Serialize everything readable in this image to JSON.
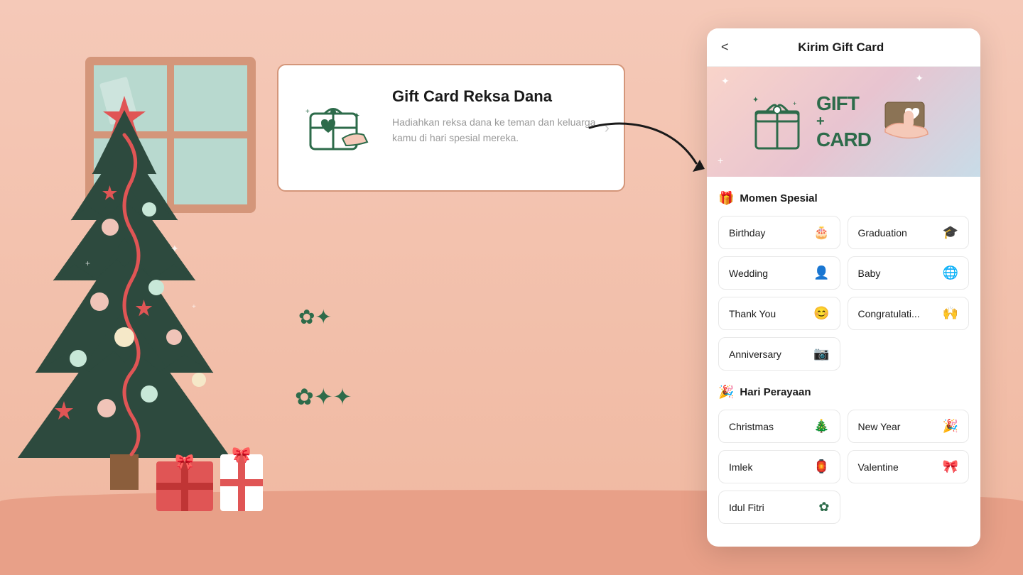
{
  "app": {
    "title": "Kirim Gift Card",
    "back_label": "<"
  },
  "feature_card": {
    "title": "Gift Card Reksa Dana",
    "description": "Hadiahkan reksa dana ke teman dan keluarga kamu di hari spesial mereka."
  },
  "banner": {
    "gift_label": "GIFT",
    "card_label": "CARD"
  },
  "sections": [
    {
      "id": "momen_spesial",
      "emoji": "🎁",
      "title": "Momen Spesial",
      "items": [
        {
          "label": "Birthday",
          "icon": "🎂"
        },
        {
          "label": "Graduation",
          "icon": "🎓"
        },
        {
          "label": "Wedding",
          "icon": "👤"
        },
        {
          "label": "Baby",
          "icon": "🌐"
        },
        {
          "label": "Thank You",
          "icon": "😊"
        },
        {
          "label": "Congratulati...",
          "icon": "🙌"
        },
        {
          "label": "Anniversary",
          "icon": "📷"
        }
      ]
    },
    {
      "id": "hari_perayaan",
      "emoji": "🎉",
      "title": "Hari Perayaan",
      "items": [
        {
          "label": "Christmas",
          "icon": "🎄"
        },
        {
          "label": "New Year",
          "icon": "🎉"
        },
        {
          "label": "Imlek",
          "icon": "🏮"
        },
        {
          "label": "Valentine",
          "icon": "🎀"
        },
        {
          "label": "Idul Fitri",
          "icon": "✿"
        }
      ]
    }
  ]
}
